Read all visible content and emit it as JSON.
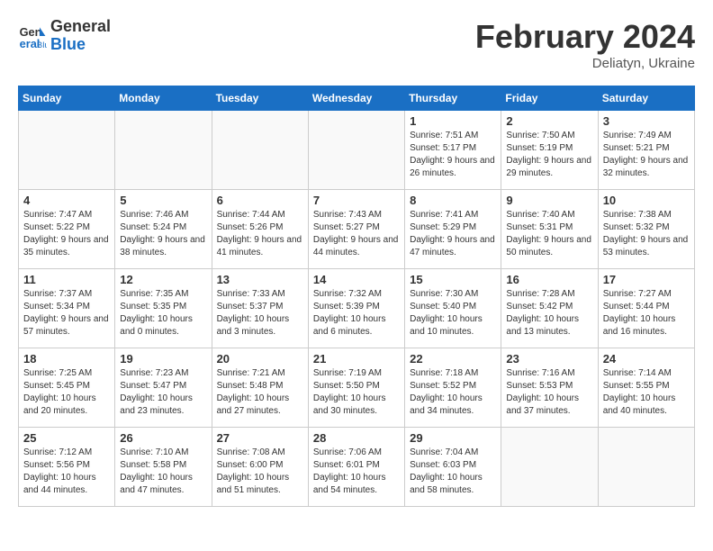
{
  "header": {
    "logo_line1": "General",
    "logo_line2": "Blue",
    "month": "February 2024",
    "location": "Deliatyn, Ukraine"
  },
  "weekdays": [
    "Sunday",
    "Monday",
    "Tuesday",
    "Wednesday",
    "Thursday",
    "Friday",
    "Saturday"
  ],
  "weeks": [
    [
      {
        "day": "",
        "sunrise": "",
        "sunset": "",
        "daylight": ""
      },
      {
        "day": "",
        "sunrise": "",
        "sunset": "",
        "daylight": ""
      },
      {
        "day": "",
        "sunrise": "",
        "sunset": "",
        "daylight": ""
      },
      {
        "day": "",
        "sunrise": "",
        "sunset": "",
        "daylight": ""
      },
      {
        "day": "1",
        "sunrise": "7:51 AM",
        "sunset": "5:17 PM",
        "daylight": "9 hours and 26 minutes."
      },
      {
        "day": "2",
        "sunrise": "7:50 AM",
        "sunset": "5:19 PM",
        "daylight": "9 hours and 29 minutes."
      },
      {
        "day": "3",
        "sunrise": "7:49 AM",
        "sunset": "5:21 PM",
        "daylight": "9 hours and 32 minutes."
      }
    ],
    [
      {
        "day": "4",
        "sunrise": "7:47 AM",
        "sunset": "5:22 PM",
        "daylight": "9 hours and 35 minutes."
      },
      {
        "day": "5",
        "sunrise": "7:46 AM",
        "sunset": "5:24 PM",
        "daylight": "9 hours and 38 minutes."
      },
      {
        "day": "6",
        "sunrise": "7:44 AM",
        "sunset": "5:26 PM",
        "daylight": "9 hours and 41 minutes."
      },
      {
        "day": "7",
        "sunrise": "7:43 AM",
        "sunset": "5:27 PM",
        "daylight": "9 hours and 44 minutes."
      },
      {
        "day": "8",
        "sunrise": "7:41 AM",
        "sunset": "5:29 PM",
        "daylight": "9 hours and 47 minutes."
      },
      {
        "day": "9",
        "sunrise": "7:40 AM",
        "sunset": "5:31 PM",
        "daylight": "9 hours and 50 minutes."
      },
      {
        "day": "10",
        "sunrise": "7:38 AM",
        "sunset": "5:32 PM",
        "daylight": "9 hours and 53 minutes."
      }
    ],
    [
      {
        "day": "11",
        "sunrise": "7:37 AM",
        "sunset": "5:34 PM",
        "daylight": "9 hours and 57 minutes."
      },
      {
        "day": "12",
        "sunrise": "7:35 AM",
        "sunset": "5:35 PM",
        "daylight": "10 hours and 0 minutes."
      },
      {
        "day": "13",
        "sunrise": "7:33 AM",
        "sunset": "5:37 PM",
        "daylight": "10 hours and 3 minutes."
      },
      {
        "day": "14",
        "sunrise": "7:32 AM",
        "sunset": "5:39 PM",
        "daylight": "10 hours and 6 minutes."
      },
      {
        "day": "15",
        "sunrise": "7:30 AM",
        "sunset": "5:40 PM",
        "daylight": "10 hours and 10 minutes."
      },
      {
        "day": "16",
        "sunrise": "7:28 AM",
        "sunset": "5:42 PM",
        "daylight": "10 hours and 13 minutes."
      },
      {
        "day": "17",
        "sunrise": "7:27 AM",
        "sunset": "5:44 PM",
        "daylight": "10 hours and 16 minutes."
      }
    ],
    [
      {
        "day": "18",
        "sunrise": "7:25 AM",
        "sunset": "5:45 PM",
        "daylight": "10 hours and 20 minutes."
      },
      {
        "day": "19",
        "sunrise": "7:23 AM",
        "sunset": "5:47 PM",
        "daylight": "10 hours and 23 minutes."
      },
      {
        "day": "20",
        "sunrise": "7:21 AM",
        "sunset": "5:48 PM",
        "daylight": "10 hours and 27 minutes."
      },
      {
        "day": "21",
        "sunrise": "7:19 AM",
        "sunset": "5:50 PM",
        "daylight": "10 hours and 30 minutes."
      },
      {
        "day": "22",
        "sunrise": "7:18 AM",
        "sunset": "5:52 PM",
        "daylight": "10 hours and 34 minutes."
      },
      {
        "day": "23",
        "sunrise": "7:16 AM",
        "sunset": "5:53 PM",
        "daylight": "10 hours and 37 minutes."
      },
      {
        "day": "24",
        "sunrise": "7:14 AM",
        "sunset": "5:55 PM",
        "daylight": "10 hours and 40 minutes."
      }
    ],
    [
      {
        "day": "25",
        "sunrise": "7:12 AM",
        "sunset": "5:56 PM",
        "daylight": "10 hours and 44 minutes."
      },
      {
        "day": "26",
        "sunrise": "7:10 AM",
        "sunset": "5:58 PM",
        "daylight": "10 hours and 47 minutes."
      },
      {
        "day": "27",
        "sunrise": "7:08 AM",
        "sunset": "6:00 PM",
        "daylight": "10 hours and 51 minutes."
      },
      {
        "day": "28",
        "sunrise": "7:06 AM",
        "sunset": "6:01 PM",
        "daylight": "10 hours and 54 minutes."
      },
      {
        "day": "29",
        "sunrise": "7:04 AM",
        "sunset": "6:03 PM",
        "daylight": "10 hours and 58 minutes."
      },
      {
        "day": "",
        "sunrise": "",
        "sunset": "",
        "daylight": ""
      },
      {
        "day": "",
        "sunrise": "",
        "sunset": "",
        "daylight": ""
      }
    ]
  ]
}
